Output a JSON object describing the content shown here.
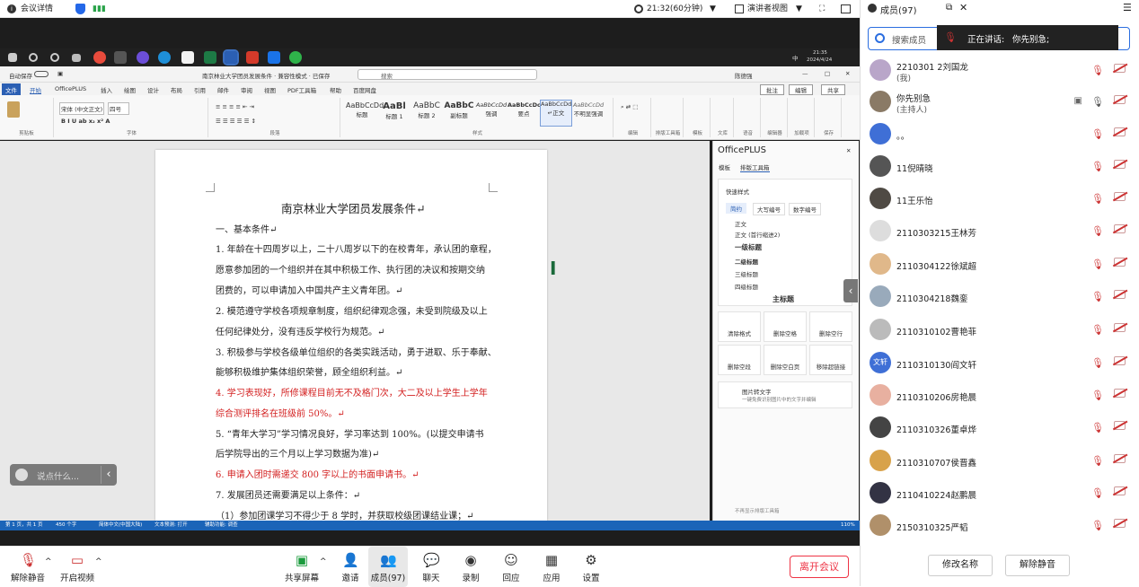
{
  "topbar": {
    "meeting_details": "会议详情",
    "time": "21:32(60分钟)",
    "view": "演讲者视图"
  },
  "taskbar": {
    "clock_time": "21:35",
    "clock_date": "2024/4/24",
    "ime": "中"
  },
  "word": {
    "title": "南京林业大学团员发展条件 · 兼容性模式 · 已保存",
    "autosave": "自动保存",
    "search": "搜索",
    "user": "陈德强",
    "tabs": [
      "文件",
      "开始",
      "OfficePLUS",
      "插入",
      "绘图",
      "设计",
      "布局",
      "引用",
      "邮件",
      "审阅",
      "视图",
      "PDF工具箱",
      "帮助",
      "百度网盘"
    ],
    "font_name": "宋体 (中文正文)",
    "font_size": "四号",
    "groups": [
      "剪贴板",
      "字体",
      "段落",
      "样式",
      "编辑",
      "排版工具箱",
      "模板",
      "文库",
      "语音",
      "编辑器",
      "加载项",
      "保存"
    ],
    "styles": [
      {
        "sample": "AaBbCcDd",
        "name": "标题"
      },
      {
        "sample": "AaBl",
        "name": "标题 1"
      },
      {
        "sample": "AaBbC",
        "name": "标题 2"
      },
      {
        "sample": "AaBbC",
        "name": "副标题"
      },
      {
        "sample": "AaBbCcDd",
        "name": "强调"
      },
      {
        "sample": "AaBbCcDc",
        "name": "要点"
      },
      {
        "sample": "AaBbCcDd",
        "name": "↵正文"
      },
      {
        "sample": "AaBbCcDd",
        "name": "不明显强调"
      }
    ],
    "comment_btn": "批注",
    "edit_btn": "编辑",
    "share_btn": "共享",
    "doc": {
      "title": "南京林业大学团员发展条件↵",
      "lines": [
        "一、基本条件↵",
        "1. 年龄在十四周岁以上，二十八周岁以下的在校青年，承认团的章程，",
        "愿意参加团的一个组织并在其中积极工作、执行团的决议和按期交纳",
        "团费的，可以申请加入中国共产主义青年团。↵",
        "2. 模范遵守学校各项规章制度，组织纪律观念强，未受到院级及以上",
        "任何纪律处分，没有违反学校行为规范。↵",
        "3. 积极参与学校各级单位组织的各类实践活动，勇于进取、乐于奉献、",
        "能够积极维护集体组织荣誉，顾全组织利益。↵",
        "4. 学习表现好，所修课程目前无不及格门次，大二及以上学生上学年",
        "综合测评排名在班级前 50%。↵",
        "5. “青年大学习”学习情况良好，学习率达到 100%。(以提交申请书",
        "后学院导出的三个月以上学习数据为准)↵",
        "6. 申请入团时需递交 800 字以上的书面申请书。↵",
        "7. 发展团员还需要满足以上条件：↵",
        "（1）参加团课学习不得少于 8 学时，并获取校级团课结业课；↵"
      ]
    },
    "status": [
      "第 1 页，共 1 页",
      "450 个字",
      "简体中文(中国大陆)",
      "文本预测: 打开",
      "辅助功能: 调查"
    ],
    "zoom": "110%"
  },
  "officeplus": {
    "title": "OfficePLUS",
    "tabs": [
      "模板",
      "排版工具箱"
    ],
    "quick_style": "快速样式",
    "modes": [
      "简约",
      "大写编号",
      "数字编号"
    ],
    "style_items": [
      "正文",
      "正文 (首行缩进2)",
      "一级标题",
      "二级标题",
      "三级标题",
      "四级标题",
      "主标题"
    ],
    "tools": [
      "清除格式",
      "删除空格",
      "删除空行",
      "删除空段",
      "删除空白页",
      "移除超链接"
    ],
    "ocr_title": "图片转文字",
    "ocr_desc": "一键免费识别图片中的文字并编辑",
    "footer": "不再显示排版工具箱"
  },
  "chat_input": "说点什么...",
  "bottombar": {
    "mute": "解除静音",
    "video": "开启视频",
    "share": "共享屏幕",
    "invite": "邀请",
    "members": "成员(97)",
    "chat": "聊天",
    "record": "录制",
    "playback": "回应",
    "apps": "应用",
    "settings": "设置",
    "leave": "离开会议"
  },
  "panel": {
    "title": "成员(97)",
    "search_placeholder": "搜索成员",
    "speaking": "正在讲话:",
    "speaker": "你先别急;",
    "members": [
      {
        "name": "2210301 2刘国龙",
        "sub": "(我)",
        "color": "#b9a6c9"
      },
      {
        "name": "你先别急",
        "sub": "(主持人)",
        "color": "#8a7a66"
      },
      {
        "name": "。。",
        "sub": "",
        "color": "#3f6fd6"
      },
      {
        "name": "11倪晴晓",
        "sub": "",
        "color": "#555"
      },
      {
        "name": "11王乐怡",
        "sub": "",
        "color": "#4f4a44"
      },
      {
        "name": "2110303215王林芳",
        "sub": "",
        "color": "#ddd"
      },
      {
        "name": "2110304122徐斌超",
        "sub": "",
        "color": "#e0b88a"
      },
      {
        "name": "2110304218魏銮",
        "sub": "",
        "color": "#9ab"
      },
      {
        "name": "2110310102曹艳菲",
        "sub": "",
        "color": "#bbb"
      },
      {
        "name": "2110310130阎文轩",
        "sub": "",
        "color": "#3f6fd6",
        "initial": "文轩"
      },
      {
        "name": "2110310206房艳晨",
        "sub": "",
        "color": "#e8b0a0"
      },
      {
        "name": "2110310326董卓烨",
        "sub": "",
        "color": "#444"
      },
      {
        "name": "2110310707侯晋鑫",
        "sub": "",
        "color": "#d8a24a"
      },
      {
        "name": "2110410224赵鹏晨",
        "sub": "",
        "color": "#334"
      },
      {
        "name": "2150310325严韬",
        "sub": "",
        "color": "#b0906a"
      }
    ],
    "rename": "修改名称",
    "unmute": "解除静音"
  }
}
